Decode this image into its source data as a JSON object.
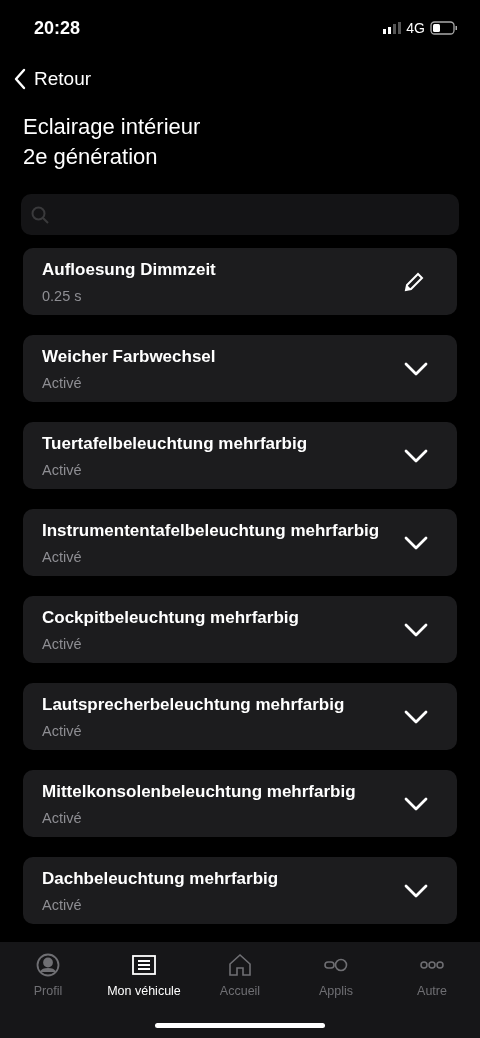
{
  "status_bar": {
    "time": "20:28",
    "network": "4G"
  },
  "back": {
    "label": "Retour"
  },
  "title": [
    "Eclairage intérieur",
    "2e génération"
  ],
  "settings": [
    {
      "kind": "edit",
      "label": "Aufloesung Dimmzeit",
      "value": "0.25 s"
    },
    {
      "kind": "dropdown",
      "label": "Weicher Farbwechsel",
      "value": "Activé"
    },
    {
      "kind": "dropdown",
      "label": "Tuertafelbeleuchtung mehrfarbig",
      "value": "Activé"
    },
    {
      "kind": "dropdown",
      "label": "Instrumententafelbeleuchtung mehrfarbig",
      "value": "Activé"
    },
    {
      "kind": "dropdown",
      "label": "Cockpitbeleuchtung mehrfarbig",
      "value": "Activé"
    },
    {
      "kind": "dropdown",
      "label": "Lautsprecherbeleuchtung mehrfarbig",
      "value": "Activé"
    },
    {
      "kind": "dropdown",
      "label": "Mittelkonsolenbeleuchtung mehrfarbig",
      "value": "Activé"
    },
    {
      "kind": "dropdown",
      "label": "Dachbeleuchtung mehrfarbig",
      "value": "Activé"
    }
  ],
  "tab_bar": [
    {
      "kind": "profile",
      "label": "Profil",
      "selected": false
    },
    {
      "kind": "vehicle",
      "label": "Mon véhicule",
      "selected": true
    },
    {
      "kind": "home",
      "label": "Accueil",
      "selected": false
    },
    {
      "kind": "apps",
      "label": "Applis",
      "selected": false
    },
    {
      "kind": "more",
      "label": "Autre",
      "selected": false
    }
  ]
}
